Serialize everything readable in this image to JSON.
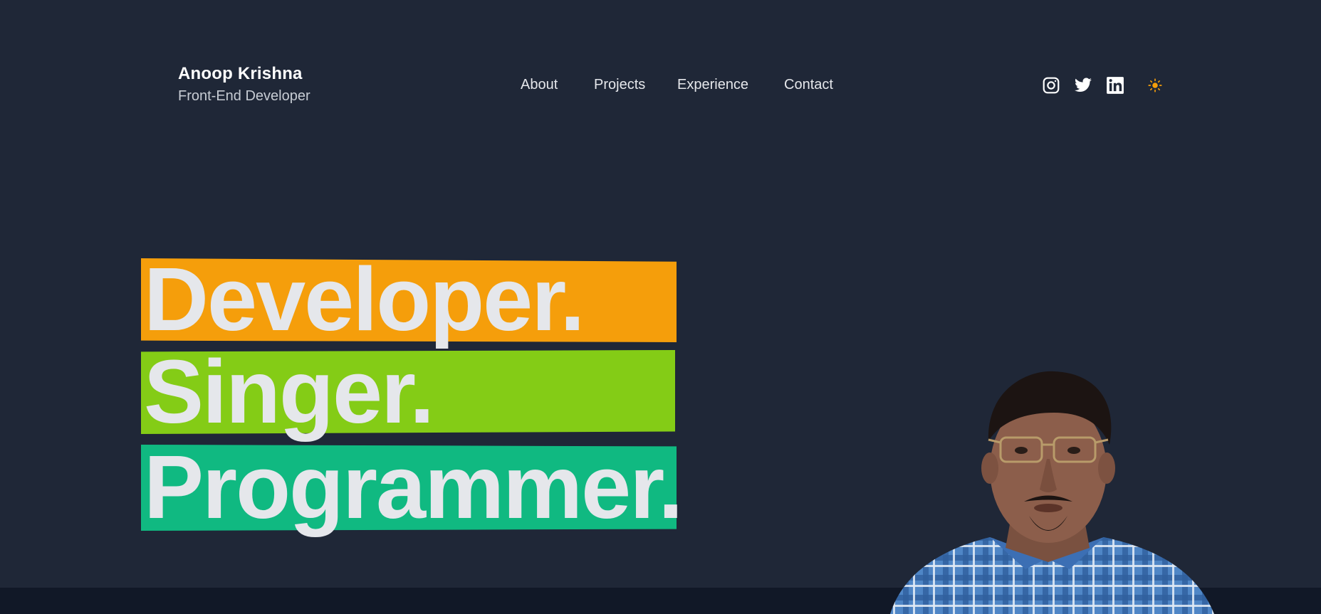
{
  "header": {
    "name": "Anoop Krishna",
    "role": "Front-End Developer"
  },
  "nav": {
    "items": [
      {
        "label": "About"
      },
      {
        "label": "Projects"
      },
      {
        "label": "Experience"
      },
      {
        "label": "Contact"
      }
    ]
  },
  "socials": {
    "icons": [
      "instagram-icon",
      "twitter-icon",
      "linkedin-icon"
    ],
    "theme_icon": "sun-icon"
  },
  "hero": {
    "words": [
      {
        "text": "Developer.",
        "color": "#f59e0b"
      },
      {
        "text": "Singer.",
        "color": "#84cc16"
      },
      {
        "text": "Programmer.",
        "color": "#10b981"
      }
    ]
  },
  "colors": {
    "background": "#1f2737",
    "footer": "#111827",
    "text": "#e5e7eb",
    "sun": "#f59e0b"
  }
}
